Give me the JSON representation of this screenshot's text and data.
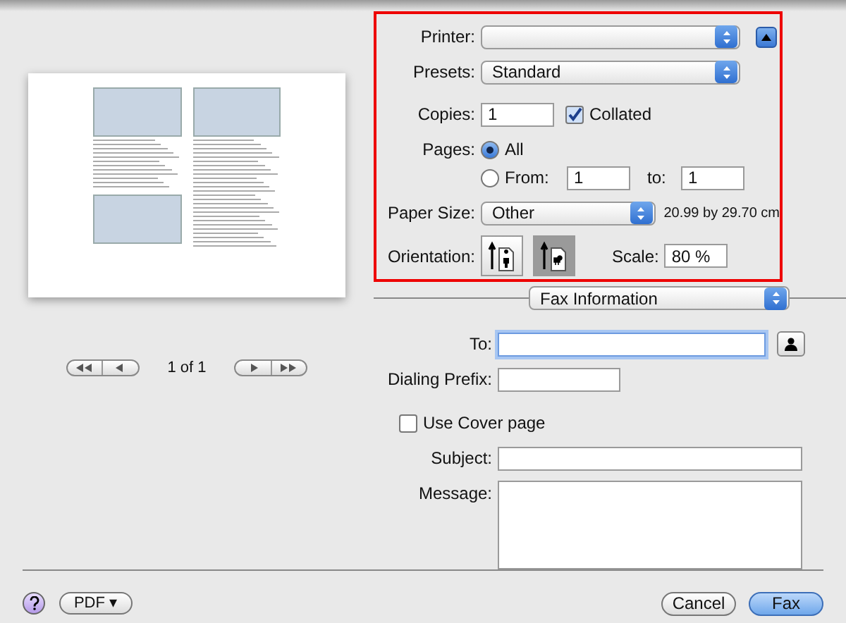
{
  "preview": {
    "page_label": "1 of 1"
  },
  "printer": {
    "label": "Printer:"
  },
  "presets": {
    "label": "Presets:",
    "value": "Standard"
  },
  "copies": {
    "label": "Copies:",
    "value": "1",
    "collated_label": "Collated",
    "collated": true
  },
  "pages": {
    "label": "Pages:",
    "options": [
      {
        "label": "All",
        "selected": true
      },
      {
        "label": "From:",
        "selected": false
      }
    ],
    "from": "1",
    "to_label": "to:",
    "to": "1"
  },
  "paper_size": {
    "label": "Paper Size:",
    "value": "Other",
    "dimensions": "20.99 by 29.70 cm"
  },
  "orientation": {
    "label": "Orientation:",
    "options": [
      {
        "kind": "portrait",
        "selected": false
      },
      {
        "kind": "landscape",
        "selected": true
      }
    ]
  },
  "scale": {
    "label": "Scale:",
    "value": "80 %"
  },
  "section": {
    "value": "Fax Information"
  },
  "fax": {
    "to_label": "To:",
    "prefix_label": "Dialing Prefix:",
    "cover_label": "Use Cover page",
    "cover": false,
    "subject_label": "Subject:",
    "message_label": "Message:"
  },
  "buttons": {
    "pdf": "PDF ▾",
    "cancel": "Cancel",
    "fax": "Fax"
  }
}
